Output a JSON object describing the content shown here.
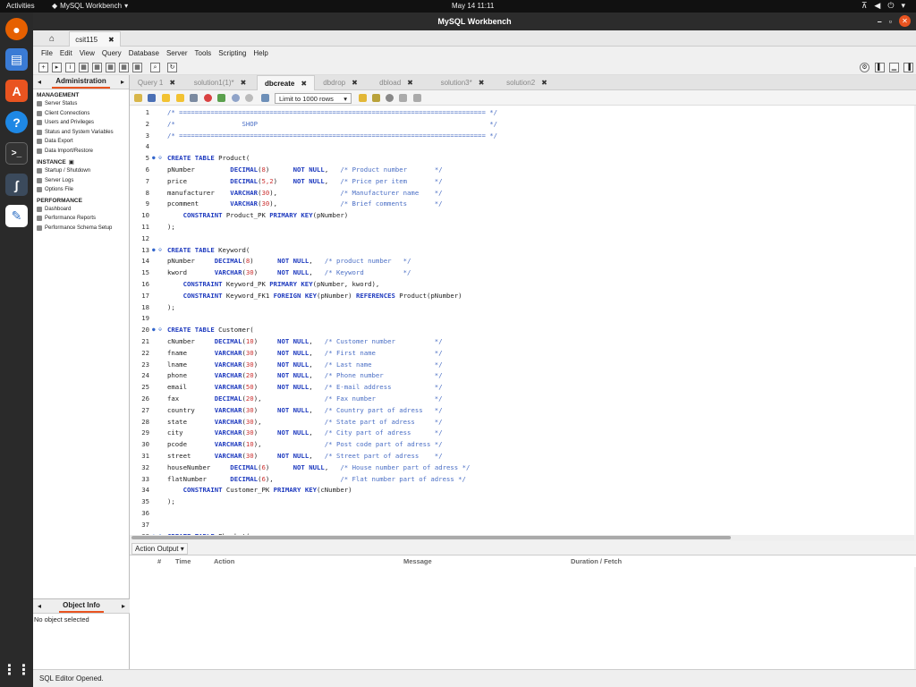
{
  "os": {
    "activities": "Activities",
    "app_menu": "MySQL Workbench",
    "clock": "May 14  11:11"
  },
  "window": {
    "title": "MySQL Workbench"
  },
  "connection_tab": {
    "label": "csit115"
  },
  "menu": [
    "File",
    "Edit",
    "View",
    "Query",
    "Database",
    "Server",
    "Tools",
    "Scripting",
    "Help"
  ],
  "sidebar": {
    "title": "Administration",
    "sections": [
      {
        "title": "MANAGEMENT",
        "items": [
          "Server Status",
          "Client Connections",
          "Users and Privileges",
          "Status and System Variables",
          "Data Export",
          "Data Import/Restore"
        ]
      },
      {
        "title": "INSTANCE",
        "items": [
          "Startup / Shutdown",
          "Server Logs",
          "Options File"
        ]
      },
      {
        "title": "PERFORMANCE",
        "items": [
          "Dashboard",
          "Performance Reports",
          "Performance Schema Setup"
        ]
      }
    ],
    "object_info_title": "Object Info",
    "object_info_text": "No object selected"
  },
  "query_tabs": [
    {
      "label": "Query 1",
      "active": false
    },
    {
      "label": "solution1(1)*",
      "active": false
    },
    {
      "label": "dbcreate",
      "active": true
    },
    {
      "label": "dbdrop",
      "active": false
    },
    {
      "label": "dbload",
      "active": false
    },
    {
      "label": "solution3*",
      "active": false
    },
    {
      "label": "solution2",
      "active": false
    }
  ],
  "limit_rows": "Limit to 1000 rows",
  "code_lines": [
    "/* ============================================================================== */",
    "/*                 SHOP                                                           */",
    "/* ============================================================================== */",
    "",
    "CREATE TABLE Product(",
    "pNumber         DECIMAL(8)      NOT NULL,   /* Product number       */",
    "price           DECIMAL(5,2)    NOT NULL,   /* Price per item       */",
    "manufacturer    VARCHAR(30),                /* Manufacturer name    */",
    "pcomment        VARCHAR(30),                /* Brief comments       */",
    "    CONSTRAINT Product_PK PRIMARY KEY(pNumber)",
    ");",
    "",
    "CREATE TABLE Keyword(",
    "pNumber     DECIMAL(8)      NOT NULL,   /* product number   */",
    "kword       VARCHAR(30)     NOT NULL,   /* Keyword          */",
    "    CONSTRAINT Keyword_PK PRIMARY KEY(pNumber, kword),",
    "    CONSTRAINT Keyword_FK1 FOREIGN KEY(pNumber) REFERENCES Product(pNumber)",
    ");",
    "",
    "CREATE TABLE Customer(",
    "cNumber     DECIMAL(10)     NOT NULL,   /* Customer number          */",
    "fname       VARCHAR(30)     NOT NULL,   /* First name               */",
    "lname       VARCHAR(30)     NOT NULL,   /* Last name                */",
    "phone       VARCHAR(20)     NOT NULL,   /* Phone number             */",
    "email       VARCHAR(50)     NOT NULL,   /* E-mail address           */",
    "fax         DECIMAL(20),                /* Fax number               */",
    "country     VARCHAR(30)     NOT NULL,   /* Country part of adress   */",
    "state       VARCHAR(30),                /* State part of adress     */",
    "city        VARCHAR(30)     NOT NULL,   /* City part of adress      */",
    "pcode       VARCHAR(10),                /* Post code part of adress */",
    "street      VARCHAR(30)     NOT NULL,   /* Street part of adress    */",
    "houseNumber     DECIMAL(6)      NOT NULL,   /* House number part of adress */",
    "flatNumber      DECIMAL(6),                 /* Flat number part of adress */",
    "    CONSTRAINT Customer_PK PRIMARY KEY(cNumber)",
    ");",
    "",
    "",
    "CREATE TABLE Pbasket("
  ],
  "output": {
    "selector": "Action Output",
    "columns": [
      "#",
      "Time",
      "Action",
      "Message",
      "Duration / Fetch"
    ]
  },
  "status": "SQL Editor Opened."
}
